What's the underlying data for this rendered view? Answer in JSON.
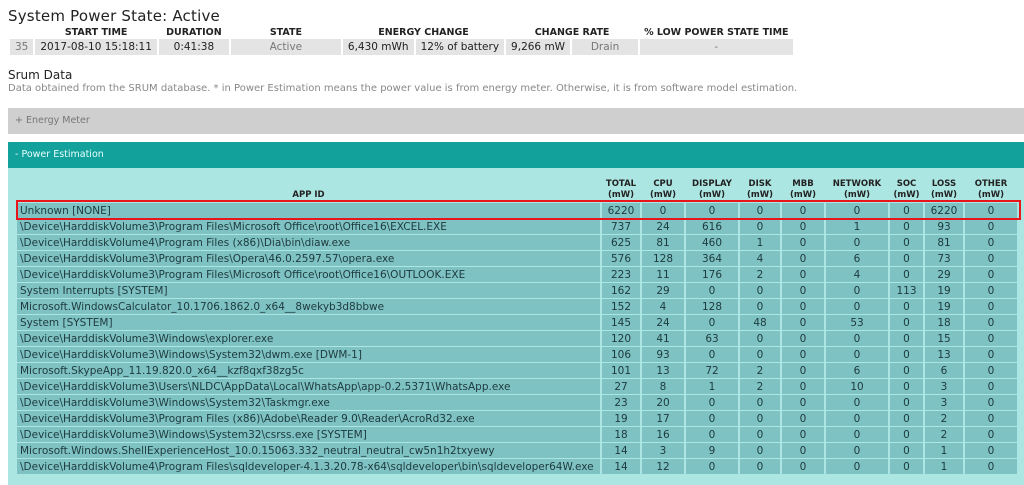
{
  "header": {
    "title": "System Power State: Active"
  },
  "state_table": {
    "headers": [
      "START TIME",
      "DURATION",
      "STATE",
      "ENERGY CHANGE",
      "CHANGE RATE",
      "% LOW POWER STATE TIME"
    ],
    "row": {
      "index": "35",
      "start_time": "2017-08-10  15:18:11",
      "duration": "0:41:38",
      "state": "Active",
      "energy_mwh": "6,430 mWh",
      "energy_pct": "12% of battery",
      "rate": "9,266 mW",
      "rate_type": "Drain",
      "low_power": "-"
    }
  },
  "srum": {
    "title": "Srum Data",
    "description": "Data obtained from the SRUM database. * in Power Estimation means the power value is from energy meter. Otherwise, it is from software model estimation."
  },
  "sections": {
    "energy_meter": "+  Energy Meter",
    "power_estimation": "-  Power Estimation"
  },
  "power_table": {
    "headers": [
      {
        "line1": "APP ID",
        "line2": ""
      },
      {
        "line1": "TOTAL",
        "line2": "(mW)"
      },
      {
        "line1": "CPU",
        "line2": "(mW)"
      },
      {
        "line1": "DISPLAY",
        "line2": "(mW)"
      },
      {
        "line1": "DISK",
        "line2": "(mW)"
      },
      {
        "line1": "MBB",
        "line2": "(mW)"
      },
      {
        "line1": "NETWORK",
        "line2": "(mW)"
      },
      {
        "line1": "SOC",
        "line2": "(mW)"
      },
      {
        "line1": "LOSS",
        "line2": "(mW)"
      },
      {
        "line1": "OTHER",
        "line2": "(mW)"
      }
    ],
    "rows": [
      [
        "Unknown [NONE]",
        "6220",
        "0",
        "0",
        "0",
        "0",
        "0",
        "0",
        "6220",
        "0"
      ],
      [
        "\\Device\\HarddiskVolume3\\Program Files\\Microsoft Office\\root\\Office16\\EXCEL.EXE",
        "737",
        "24",
        "616",
        "0",
        "0",
        "1",
        "0",
        "93",
        "0"
      ],
      [
        "\\Device\\HarddiskVolume4\\Program Files (x86)\\Dia\\bin\\diaw.exe",
        "625",
        "81",
        "460",
        "1",
        "0",
        "0",
        "0",
        "81",
        "0"
      ],
      [
        "\\Device\\HarddiskVolume3\\Program Files\\Opera\\46.0.2597.57\\opera.exe",
        "576",
        "128",
        "364",
        "4",
        "0",
        "6",
        "0",
        "73",
        "0"
      ],
      [
        "\\Device\\HarddiskVolume3\\Program Files\\Microsoft Office\\root\\Office16\\OUTLOOK.EXE",
        "223",
        "11",
        "176",
        "2",
        "0",
        "4",
        "0",
        "29",
        "0"
      ],
      [
        "System Interrupts [SYSTEM]",
        "162",
        "29",
        "0",
        "0",
        "0",
        "0",
        "113",
        "19",
        "0"
      ],
      [
        "Microsoft.WindowsCalculator_10.1706.1862.0_x64__8wekyb3d8bbwe",
        "152",
        "4",
        "128",
        "0",
        "0",
        "0",
        "0",
        "19",
        "0"
      ],
      [
        "System [SYSTEM]",
        "145",
        "24",
        "0",
        "48",
        "0",
        "53",
        "0",
        "18",
        "0"
      ],
      [
        "\\Device\\HarddiskVolume3\\Windows\\explorer.exe",
        "120",
        "41",
        "63",
        "0",
        "0",
        "0",
        "0",
        "15",
        "0"
      ],
      [
        "\\Device\\HarddiskVolume3\\Windows\\System32\\dwm.exe [DWM-1]",
        "106",
        "93",
        "0",
        "0",
        "0",
        "0",
        "0",
        "13",
        "0"
      ],
      [
        "Microsoft.SkypeApp_11.19.820.0_x64__kzf8qxf38zg5c",
        "101",
        "13",
        "72",
        "2",
        "0",
        "6",
        "0",
        "6",
        "0"
      ],
      [
        "\\Device\\HarddiskVolume3\\Users\\NLDC\\AppData\\Local\\WhatsApp\\app-0.2.5371\\WhatsApp.exe",
        "27",
        "8",
        "1",
        "2",
        "0",
        "10",
        "0",
        "3",
        "0"
      ],
      [
        "\\Device\\HarddiskVolume3\\Windows\\System32\\Taskmgr.exe",
        "23",
        "20",
        "0",
        "0",
        "0",
        "0",
        "0",
        "3",
        "0"
      ],
      [
        "\\Device\\HarddiskVolume3\\Program Files (x86)\\Adobe\\Reader 9.0\\Reader\\AcroRd32.exe",
        "19",
        "17",
        "0",
        "0",
        "0",
        "0",
        "0",
        "2",
        "0"
      ],
      [
        "\\Device\\HarddiskVolume3\\Windows\\System32\\csrss.exe [SYSTEM]",
        "18",
        "16",
        "0",
        "0",
        "0",
        "0",
        "0",
        "2",
        "0"
      ],
      [
        "Microsoft.Windows.ShellExperienceHost_10.0.15063.332_neutral_neutral_cw5n1h2txyewy",
        "14",
        "3",
        "9",
        "0",
        "0",
        "0",
        "0",
        "1",
        "0"
      ],
      [
        "\\Device\\HarddiskVolume4\\Program Files\\sqldeveloper-4.1.3.20.78-x64\\sqldeveloper\\bin\\sqldeveloper64W.exe",
        "14",
        "12",
        "0",
        "0",
        "0",
        "0",
        "0",
        "1",
        "0"
      ]
    ]
  },
  "colors": {
    "accent": "#13a19b",
    "panel": "#ace6e2",
    "cell": "#7fc2c4",
    "highlight": "#e8151b"
  }
}
